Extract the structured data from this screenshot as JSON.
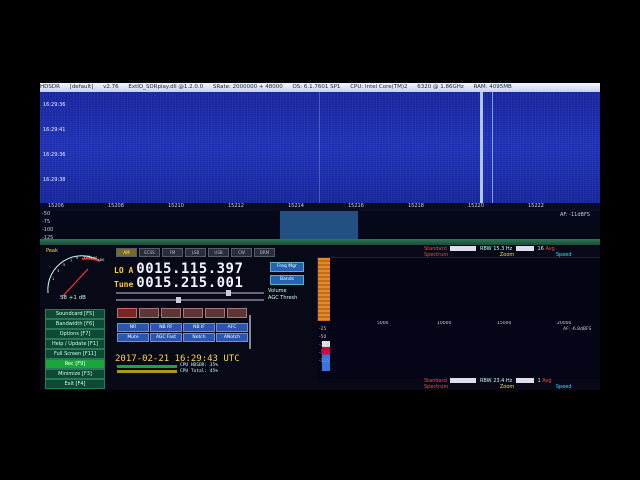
{
  "titlebar": {
    "parts": [
      "HDSDR",
      "[default]",
      "v2.76",
      "ExtIO_SDRplay.dll @1.2.0.0",
      "SRate: 2000000 + 48000",
      "OS: 6.1.7601 SP1",
      "CPU: Intel Core(TM)2",
      "6320 @ 1.86GHz",
      "RAM: 4095MB"
    ]
  },
  "waterfall": {
    "time_labels": [
      "16:29:36",
      "16:29:41",
      "16:29:36",
      "16:29:38"
    ],
    "freq_ticks": [
      "15206",
      "15208",
      "15210",
      "15212",
      "15214",
      "15216",
      "15218",
      "15220",
      "15222"
    ],
    "spec_labels": [
      "-50",
      "-75",
      "-100",
      "-125"
    ],
    "spec_right": "AF: -11dBFS"
  },
  "smeter": {
    "peak_label": "Peak",
    "reading": "S8 +1 dB",
    "scale_labels": [
      "1",
      "3",
      "5",
      "7",
      "9",
      "+20",
      "+40",
      "+60"
    ]
  },
  "menu": [
    {
      "label": "Soundcard   [F5]",
      "hl": false
    },
    {
      "label": "Bandwidth   [F6]",
      "hl": false
    },
    {
      "label": "Options   [F7]",
      "hl": false
    },
    {
      "label": "Help / Update   [F1]",
      "hl": false
    },
    {
      "label": "Full Screen   [F11]",
      "hl": false
    },
    {
      "label": "Rec   [F9]",
      "hl": true
    },
    {
      "label": "Minimize   [F3]",
      "hl": false
    },
    {
      "label": "Exit   [F4]",
      "hl": false
    }
  ],
  "modes": [
    {
      "label": "AM",
      "on": true
    },
    {
      "label": "ECSS",
      "on": false
    },
    {
      "label": "FM",
      "on": false
    },
    {
      "label": "LSB",
      "on": false
    },
    {
      "label": "USB",
      "on": false
    },
    {
      "label": "CW",
      "on": false
    },
    {
      "label": "DRM",
      "on": false
    }
  ],
  "lo": {
    "label": "LO A",
    "value": "0015.115.397"
  },
  "tune": {
    "label": "Tune",
    "value": "0015.215.001"
  },
  "side_buttons": [
    "Freq Mgr",
    "Bands"
  ],
  "volume_label": "Volume",
  "agc_label": "AGC Thresh",
  "mode_buttons": [
    "NR",
    "NB RF",
    "NB IF",
    "AFC",
    "Mute",
    "AGC Fast",
    "Notch",
    "ANotch"
  ],
  "datetime": "2017-02-21   16:29:43 UTC",
  "cpu": [
    "CPU HDSDR:   35%",
    "CPU Total:   45%"
  ],
  "audio": {
    "freq_ticks": [
      "5000",
      "10000",
      "15000",
      "20000"
    ],
    "ylabels": [
      "-25",
      "-50",
      "-75",
      "-100",
      "-125"
    ],
    "right_label": "AF: -6.8dBFS"
  },
  "ctrl_top": {
    "standard": "Standard",
    "rbw": "RBW 15.3 Hz",
    "zoom": "Zoom",
    "avg": "Avg",
    "spectrum": "Spectrum",
    "speed": "Speed",
    "val": "16"
  },
  "ctrl_bottom": {
    "standard": "Standard",
    "rbw": "RBW 23.4 Hz",
    "zoom": "Zoom",
    "avg": "Avg",
    "spectrum": "Spectrum",
    "speed": "Speed",
    "val": "1"
  }
}
